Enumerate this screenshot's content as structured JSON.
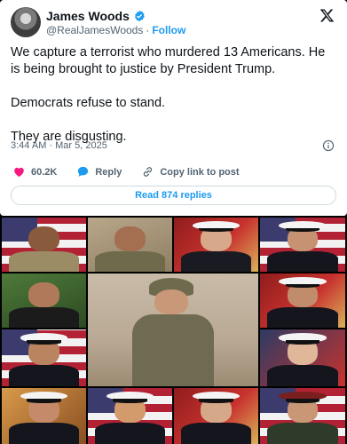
{
  "post": {
    "author_name": "James Woods",
    "handle": "@RealJamesWoods",
    "separator": "·",
    "follow_label": "Follow",
    "paragraphs": [
      "We capture a terrorist who murdered 13 Americans. He is being brought to justice by President Trump.",
      "Democrats refuse to stand.",
      "They are disgusting."
    ],
    "timestamp": "3:44 AM · Mar 5, 2025",
    "like_count": "60.2K",
    "reply_label": "Reply",
    "copy_link_label": "Copy link to post",
    "read_replies_label": "Read 874 replies"
  },
  "icons": {
    "verified": "verified-badge-icon",
    "platform": "x-logo-icon",
    "info": "info-icon",
    "like": "heart-icon",
    "reply": "speech-bubble-icon",
    "copy_link": "link-icon"
  },
  "colors": {
    "accent": "#1d9bf0",
    "like": "#f91880",
    "muted_text": "#536471",
    "text": "#0f1419"
  },
  "collage": {
    "photo_count": 13
  }
}
